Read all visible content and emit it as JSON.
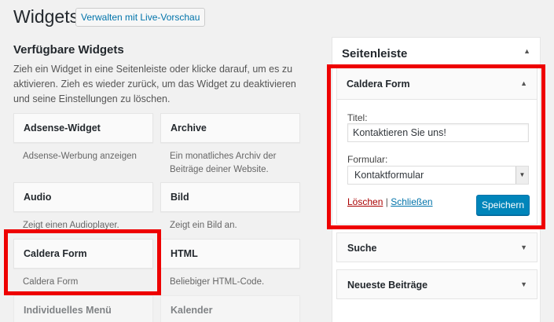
{
  "header": {
    "title": "Widgets",
    "live_preview_label": "Verwalten mit Live-Vorschau"
  },
  "available": {
    "title": "Verfügbare Widgets",
    "description": "Zieh ein Widget in eine Seitenleiste oder klicke darauf, um es zu aktivieren. Zieh es wieder zurück, um das Widget zu deaktivieren und seine Einstellungen zu löschen.",
    "widgets": [
      {
        "title": "Adsense-Widget",
        "desc": "Adsense-Werbung anzeigen"
      },
      {
        "title": "Archive",
        "desc": "Ein monatliches Archiv der Beiträge deiner Website."
      },
      {
        "title": "Audio",
        "desc": "Zeigt einen Audioplayer."
      },
      {
        "title": "Bild",
        "desc": "Zeigt ein Bild an."
      },
      {
        "title": "Caldera Form",
        "desc": "Caldera Form"
      },
      {
        "title": "HTML",
        "desc": "Beliebiger HTML-Code."
      },
      {
        "title": "Individuelles Menü",
        "desc": ""
      },
      {
        "title": "Kalender",
        "desc": ""
      }
    ]
  },
  "sidebar": {
    "title": "Seitenleiste",
    "caldera": {
      "title": "Caldera Form",
      "titel_label": "Titel:",
      "titel_value": "Kontaktieren Sie uns!",
      "form_label": "Formular:",
      "form_value": "Kontaktformular",
      "delete_label": "Löschen",
      "separator": "|",
      "close_label": "Schließen",
      "save_label": "Speichern"
    },
    "widgets": [
      {
        "title": "Suche"
      },
      {
        "title": "Neueste Beiträge"
      }
    ]
  },
  "colors": {
    "highlight": "#e00000",
    "primary_button": "#0085ba",
    "link": "#0073aa",
    "delete_link": "#aa0000"
  }
}
